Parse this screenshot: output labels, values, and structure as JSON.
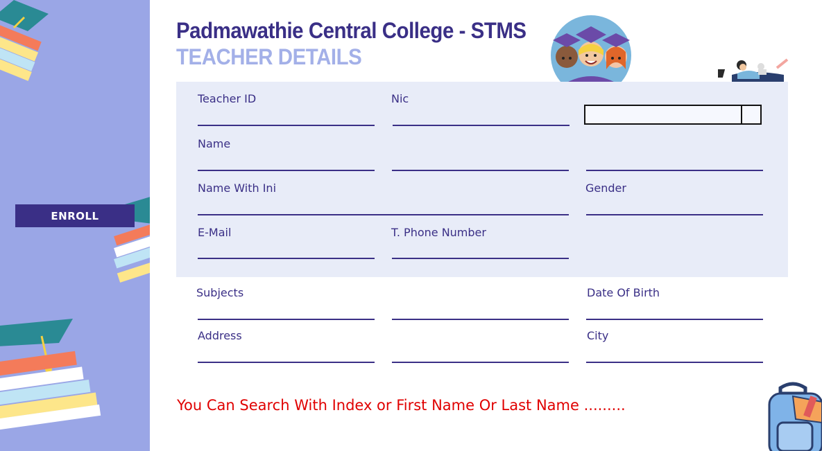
{
  "header": {
    "title": "Padmawathie Central College - STMS",
    "subtitle": "TEACHER DETAILS"
  },
  "sidebar": {
    "enroll_label": "ENROLL"
  },
  "form": {
    "teacher_id_label": "Teacher ID",
    "nic_label": "Nic",
    "name_label": "Name",
    "name_with_ini_label": "Name With Ini",
    "gender_label": "Gender",
    "email_label": "E-Mail",
    "phone_label": "T. Phone Number",
    "subjects_label": "Subjects",
    "dob_label": "Date Of Birth",
    "address_label": "Address",
    "city_label": "City"
  },
  "hint_text": "You Can Search With Index or First Name Or Last Name .........",
  "colors": {
    "primary": "#3a2f86",
    "sidebar": "#9aa6e6",
    "panel": "#e8ecf8",
    "hint": "#e00000"
  }
}
